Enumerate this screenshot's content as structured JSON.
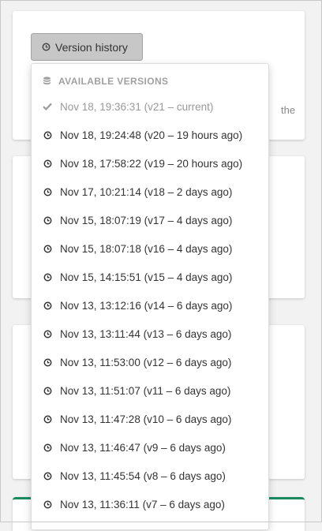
{
  "colors": {
    "page_background": "#f2f2f2",
    "button_background": "#c7c7c7",
    "accent_green": "#1a8a5e",
    "muted_text": "#999999"
  },
  "card": {
    "partial_text": "the"
  },
  "version_button": {
    "icon": "clock-icon",
    "label": "Version history"
  },
  "dropdown": {
    "header": {
      "icon": "database-icon",
      "label": "AVAILABLE VERSIONS"
    },
    "items": [
      {
        "icon": "checkmark-icon",
        "label": "Nov 18, 19:36:31 (v21 – current)",
        "current": true
      },
      {
        "icon": "clock-icon",
        "label": "Nov 18, 19:24:48 (v20 – 19 hours ago)"
      },
      {
        "icon": "clock-icon",
        "label": "Nov 18, 17:58:22 (v19 – 20 hours ago)"
      },
      {
        "icon": "clock-icon",
        "label": "Nov 17, 10:21:14 (v18 – 2 days ago)"
      },
      {
        "icon": "clock-icon",
        "label": "Nov 15, 18:07:19 (v17 – 4 days ago)"
      },
      {
        "icon": "clock-icon",
        "label": "Nov 15, 18:07:18 (v16 – 4 days ago)"
      },
      {
        "icon": "clock-icon",
        "label": "Nov 15, 14:15:51 (v15 – 4 days ago)"
      },
      {
        "icon": "clock-icon",
        "label": "Nov 13, 13:12:16 (v14 – 6 days ago)"
      },
      {
        "icon": "clock-icon",
        "label": "Nov 13, 13:11:44 (v13 – 6 days ago)"
      },
      {
        "icon": "clock-icon",
        "label": "Nov 13, 11:53:00 (v12 – 6 days ago)"
      },
      {
        "icon": "clock-icon",
        "label": "Nov 13, 11:51:07 (v11 – 6 days ago)"
      },
      {
        "icon": "clock-icon",
        "label": "Nov 13, 11:47:28 (v10 – 6 days ago)"
      },
      {
        "icon": "clock-icon",
        "label": "Nov 13, 11:46:47 (v9 – 6 days ago)"
      },
      {
        "icon": "clock-icon",
        "label": "Nov 13, 11:45:54 (v8 – 6 days ago)"
      },
      {
        "icon": "clock-icon",
        "label": "Nov 13, 11:36:11 (v7 – 6 days ago)"
      }
    ]
  }
}
